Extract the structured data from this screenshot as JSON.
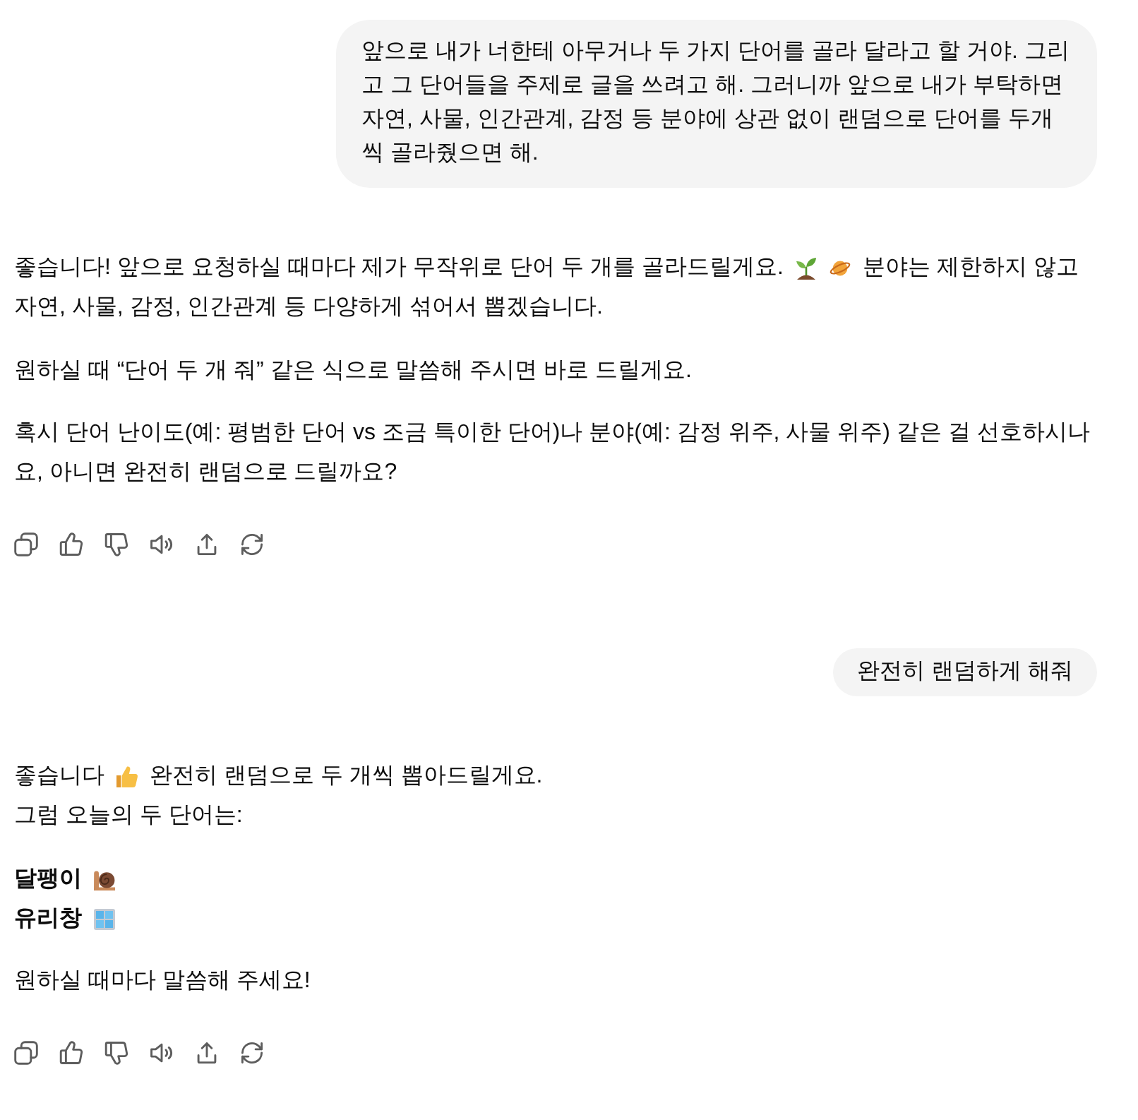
{
  "messages": [
    {
      "kind": "user",
      "text": "앞으로 내가 너한테 아무거나 두 가지 단어를 골라 달라고 할 거야. 그리고 그 단어들을 주제로 글을 쓰려고 해. 그러니까 앞으로 내가 부탁하면 자연, 사물, 인간관계, 감정 등 분야에 상관 없이 랜덤으로 단어를 두개씩 골라줬으면 해."
    },
    {
      "kind": "assistant",
      "paragraphs": [
        {
          "lines": [
            [
              {
                "kind": "text",
                "text": "좋습니다! 앞으로 요청하실 때마다 제가 무작위로 단어 두 개를 골라드릴게요."
              },
              {
                "kind": "icon"
              },
              {
                "kind": "icon"
              },
              {
                "kind": "text",
                "text": "분야는 제한하지 않고"
              }
            ],
            [
              {
                "kind": "text",
                "text": "자연, 사물, 감정, 인간관계 등 다양하게 섞어서 뽑겠습니다."
              }
            ]
          ]
        },
        {
          "lines": [
            [
              {
                "kind": "text",
                "text": "원하실 때 “단어 두 개 줘” 같은 식으로 말씀해 주시면 바로 드릴게요."
              }
            ]
          ]
        },
        {
          "lines": [
            [
              {
                "kind": "text",
                "text": "혹시 단어 난이도(예: 평범한 단어 vs 조금 특이한 단어)나 분야(예: 감정 위주, 사물 위주) 같은 걸 선호하시나요, 아니면 완전히 랜덤으로 드릴까요?"
              }
            ]
          ]
        }
      ]
    },
    {
      "kind": "user",
      "text": "완전히 랜덤하게 해줘"
    },
    {
      "kind": "assistant",
      "paragraphs": [
        {
          "lines": [
            [
              {
                "kind": "text",
                "text": "좋습니다"
              },
              {
                "kind": "icon"
              },
              {
                "kind": "text",
                "text": "완전히 랜덤으로 두 개씩 뽑아드릴게요."
              }
            ],
            [
              {
                "kind": "text",
                "text": "그럼 오늘의 두 단어는:"
              }
            ]
          ]
        },
        {
          "lines": [
            [
              {
                "kind": "strong",
                "text": "달팽이"
              },
              {
                "kind": "icon"
              }
            ],
            [
              {
                "kind": "strong",
                "text": "유리창"
              },
              {
                "kind": "icon"
              }
            ]
          ]
        },
        {
          "lines": [
            [
              {
                "kind": "text",
                "text": "원하실 때마다 말씀해 주세요!"
              }
            ]
          ]
        }
      ]
    }
  ]
}
